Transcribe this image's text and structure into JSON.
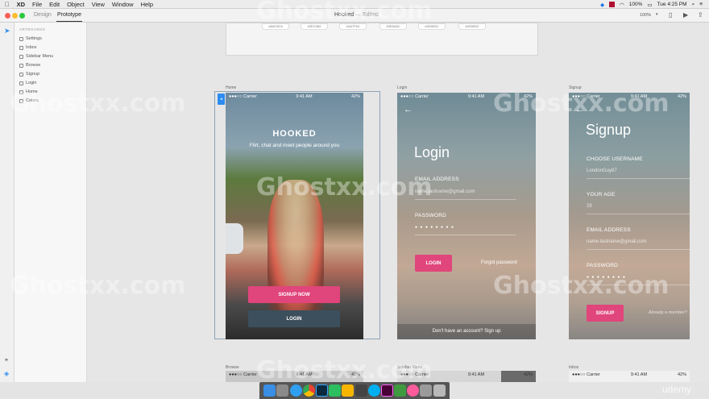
{
  "menubar": {
    "items": [
      "XD",
      "File",
      "Edit",
      "Object",
      "View",
      "Window",
      "Help"
    ],
    "right_zoom": "100%",
    "right_time": "Tue 4:25 PM"
  },
  "window": {
    "title": "Hooked",
    "subtitle": "— Edited",
    "tab_design": "Design",
    "tab_prototype": "Prototype",
    "zoom": "100%"
  },
  "layers": {
    "header": "ARTBOARDS",
    "items": [
      "Settings",
      "Inbox",
      "Sidebar Menu",
      "Browse",
      "Signup",
      "Login",
      "Home",
      "Colors"
    ]
  },
  "swatches": [
    "#A8C8C8",
    "#3EC089",
    "#4A7F64",
    "#3E5A6C",
    "#4D5E6C",
    "#4D5E6C"
  ],
  "home": {
    "label": "Home",
    "carrier": "●●●○○ Carrier",
    "time": "9:41 AM",
    "battery": "42%",
    "title": "HOOKED",
    "tagline": "Flirt, chat and meet people around you",
    "signup": "SIGNUP NOW",
    "login": "LOGIN"
  },
  "login": {
    "label": "Login",
    "carrier": "●●●○○ Carrier",
    "time": "9:41 AM",
    "battery": "42%",
    "back": "←",
    "title": "Login",
    "email_label": "EMAIL ADDRESS",
    "email_value": "name.lastname@gmail.com",
    "password_label": "PASSWORD",
    "password_value": "● ● ● ● ● ● ● ●",
    "button": "LOGIN",
    "forgot": "Forgot password",
    "footer": "Don't have an account? Sign up"
  },
  "signup": {
    "label": "Signup",
    "carrier": "●●●○○ Carrier",
    "time": "9:41 AM",
    "battery": "42%",
    "back": "←",
    "title": "Signup",
    "username_label": "CHOOSE USERNAME",
    "username_value": "LondonGuy87",
    "age_label": "YOUR AGE",
    "age_value": "29",
    "email_label": "EMAIL ADDRESS",
    "email_value": "name.lastname@gmail.com",
    "password_label": "PASSWORD",
    "password_value": "● ● ● ● ● ● ● ●",
    "button": "SIGNUP",
    "member": "Already a member?"
  },
  "bottom_boards": {
    "browse": "Browse",
    "sidebar": "Sidebar Menu",
    "inbox": "Inbox",
    "carrier": "●●●○○ Carrier",
    "time": "9:41 AM",
    "battery": "42%"
  },
  "watermark": "Ghostxx.com",
  "udemy": "udemy",
  "colors": {
    "pink": "#e0457b",
    "dark_btn": "#3c4f5c",
    "accent": "#2d8cf0"
  }
}
